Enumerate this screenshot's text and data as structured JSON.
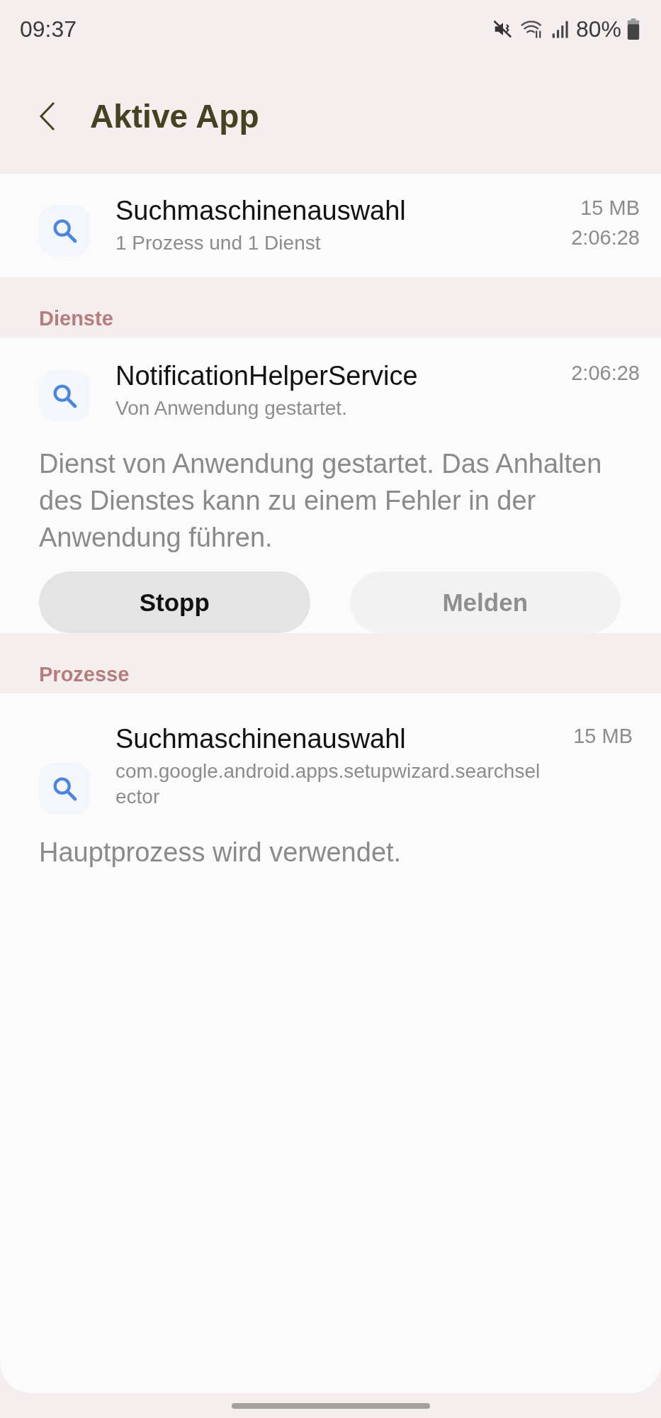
{
  "status_bar": {
    "time": "09:37",
    "battery": "80%"
  },
  "header": {
    "title": "Aktive App"
  },
  "app": {
    "name": "Suchmaschinenauswahl",
    "summary": "1 Prozess und 1 Dienst",
    "memory": "15 MB",
    "uptime": "2:06:28"
  },
  "services": {
    "heading": "Dienste",
    "items": [
      {
        "name": "NotificationHelperService",
        "subtitle": "Von Anwendung gestartet.",
        "uptime": "2:06:28",
        "description": "Dienst von Anwendung gestartet. Das Anhalten des Dienstes kann zu einem Fehler in der Anwendung führen.",
        "buttons": [
          {
            "label": "Stopp",
            "disabled": false
          },
          {
            "label": "Melden",
            "disabled": true
          }
        ]
      }
    ]
  },
  "processes": {
    "heading": "Prozesse",
    "items": [
      {
        "name": "Suchmaschinenauswahl",
        "package": "com.google.android.apps.setupwizard.searchselector",
        "memory": "15 MB",
        "description": "Hauptprozess wird verwendet."
      }
    ]
  }
}
